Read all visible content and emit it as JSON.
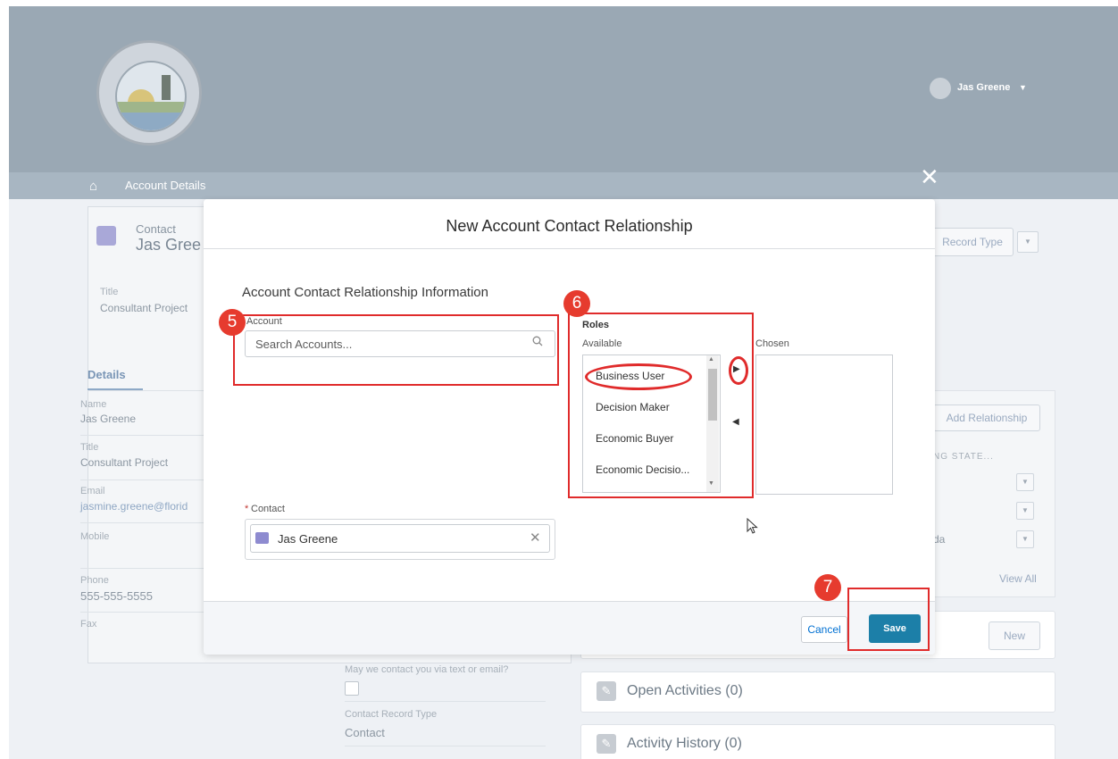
{
  "header": {
    "user_name": "Jas Greene",
    "user_chevron": "▼",
    "home_icon": "⌂",
    "breadcrumb": "Account Details",
    "close_icon": "✕"
  },
  "background": {
    "contact_label": "Contact",
    "contact_name": "Jas Gree",
    "title_label": "Title",
    "title_value": "Consultant Project",
    "details_tab": "Details",
    "name_label": "Name",
    "name_value": "Jas Greene",
    "title2_label": "Title",
    "title2_value": "Consultant Project",
    "email_label": "Email",
    "email_value": "jasmine.greene@florid",
    "mobile_label": "Mobile",
    "phone_label": "Phone",
    "phone_value": "555-555-5555",
    "fax_label": "Fax",
    "record_type_button": "Record Type",
    "add_relationship_button": "Add Relationship",
    "col_header": "NG STATE...",
    "row3_text": "da",
    "view_all": "View All",
    "new_button": "New",
    "contact_pref_label": "May we contact you via text or email?",
    "record_type_label": "Contact Record Type",
    "record_type_value": "Contact",
    "open_activities": "Open Activities (0)",
    "activity_history": "Activity History (0)"
  },
  "modal": {
    "title": "New Account Contact Relationship",
    "section_title": "Account Contact Relationship Information",
    "account_label": "Account",
    "account_placeholder": "Search Accounts...",
    "contact_required_mark": "*",
    "contact_label": "Contact",
    "contact_value": "Jas Greene",
    "roles_label": "Roles",
    "available_label": "Available",
    "chosen_label": "Chosen",
    "available_roles": [
      "Business User",
      "Decision Maker",
      "Economic Buyer",
      "Economic Decisio..."
    ],
    "cancel_label": "Cancel",
    "save_label": "Save"
  },
  "annotations": {
    "step5": "5",
    "step6": "6",
    "step7": "7",
    "color": "#e02b2b"
  }
}
